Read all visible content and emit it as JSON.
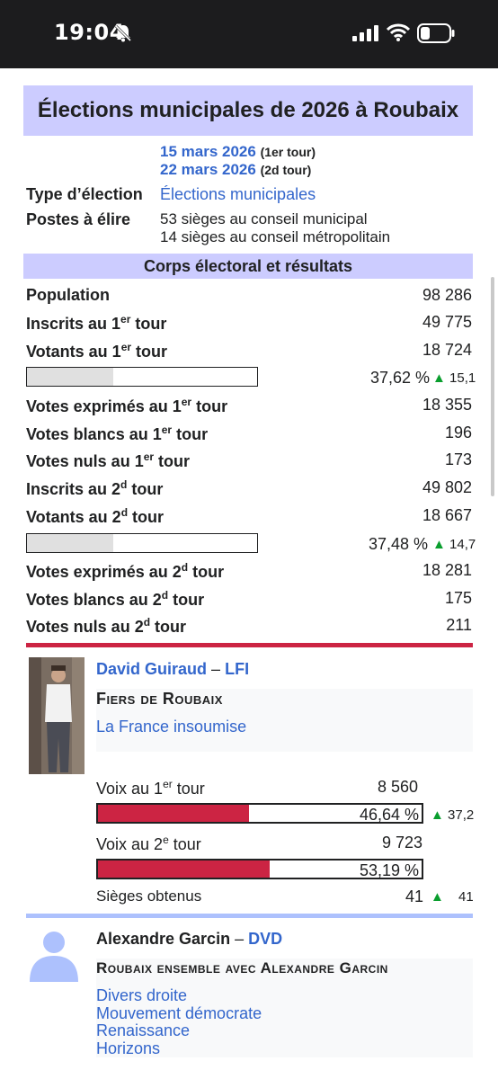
{
  "status": {
    "time": "19:04"
  },
  "infobox": {
    "title": "Élections municipales de 2026 à Roubaix",
    "dates": [
      {
        "date": "15 mars 2026",
        "tour": "(1er tour)"
      },
      {
        "date": "22 mars 2026",
        "tour": "(2d tour)"
      }
    ],
    "type_label": "Type d’élection",
    "type_value": "Élections municipales",
    "postes_label": "Postes à élire",
    "postes_value1": "53 sièges au conseil municipal",
    "postes_value2": "14 sièges au conseil métropolitain",
    "section_title": "Corps électoral et résultats",
    "rows": {
      "population": {
        "label": "Population",
        "value": "98 286"
      },
      "inscrits1": {
        "label": "Inscrits au 1",
        "sup": "er",
        "suffix": " tour",
        "value": "49 775"
      },
      "votants1": {
        "label": "Votants au 1",
        "sup": "er",
        "suffix": " tour",
        "value": "18 724"
      },
      "participation1": {
        "pct": "37,62 %",
        "delta": "15,1",
        "fill": 0.3762
      },
      "exprimes1": {
        "label": "Votes exprimés au 1",
        "sup": "er",
        "suffix": " tour",
        "value": "18 355"
      },
      "blancs1": {
        "label": "Votes blancs au 1",
        "sup": "er",
        "suffix": " tour",
        "value": "196"
      },
      "nuls1": {
        "label": "Votes nuls au 1",
        "sup": "er",
        "suffix": " tour",
        "value": "173"
      },
      "inscrits2": {
        "label": "Inscrits au 2",
        "sup": "d",
        "suffix": " tour",
        "value": "49 802"
      },
      "votants2": {
        "label": "Votants au 2",
        "sup": "d",
        "suffix": " tour",
        "value": "18 667"
      },
      "participation2": {
        "pct": "37,48 %",
        "delta": "14,7",
        "fill": 0.3748
      },
      "exprimes2": {
        "label": "Votes exprimés au 2",
        "sup": "d",
        "suffix": " tour",
        "value": "18 281"
      },
      "blancs2": {
        "label": "Votes blancs au 2",
        "sup": "d",
        "suffix": " tour",
        "value": "175"
      },
      "nuls2": {
        "label": "Votes nuls au 2",
        "sup": "d",
        "suffix": " tour",
        "value": "211"
      }
    },
    "candidate1": {
      "color": "#cc2443",
      "name": "David Guiraud",
      "dash": "–",
      "party_abbr": "LFI",
      "list": "Fiers de Roubaix",
      "party": "La France insoumise",
      "voix1_label": "Voix au 1",
      "voix1_sup": "er",
      "voix1_suffix": " tour",
      "voix1_value": "8 560",
      "pct1": "46,64 %",
      "pct1_fill": 0.4664,
      "pct1_delta": "37,2",
      "voix2_label": "Voix au 2",
      "voix2_sup": "e",
      "voix2_suffix": " tour",
      "voix2_value": "9 723",
      "pct2": "53,19 %",
      "pct2_fill": 0.5319,
      "sieges_label": "Sièges obtenus",
      "sieges_value": "41",
      "sieges_delta": "41"
    },
    "candidate2": {
      "color": "#adc1fd",
      "name": "Alexandre Garcin",
      "dash": "–",
      "party_abbr": "DVD",
      "list": "Roubaix ensemble avec Alexandre Garcin",
      "parties": [
        "Divers droite",
        "Mouvement démocrate",
        "Renaissance",
        "Horizons"
      ]
    }
  }
}
